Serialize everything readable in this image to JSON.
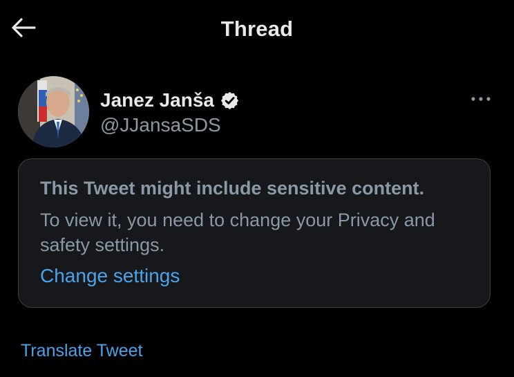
{
  "header": {
    "title": "Thread",
    "back_icon": "arrow-left-icon"
  },
  "author": {
    "name": "Janez Janša",
    "handle": "@JJansaSDS",
    "verified": true,
    "verified_icon": "verified-badge-icon",
    "more_icon": "more-horizontal-icon"
  },
  "sensitive_notice": {
    "title": "This Tweet might include sensitive content.",
    "body": "To view it, you need to change your Privacy and safety settings.",
    "action_label": "Change settings"
  },
  "footer": {
    "translate_label": "Translate Tweet"
  },
  "colors": {
    "background": "#000000",
    "primary_text": "#e7e9ea",
    "secondary_text": "#8b98a5",
    "link": "#4ba3ea",
    "card_border": "#3e4246",
    "card_bg": "#16181c"
  }
}
